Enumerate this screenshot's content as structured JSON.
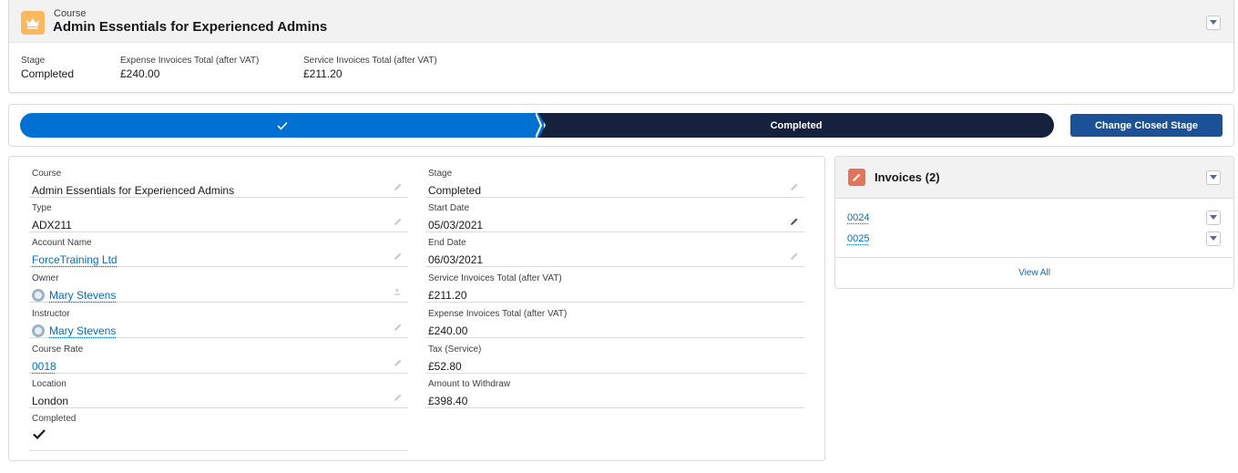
{
  "header": {
    "object_type": "Course",
    "title": "Admin Essentials for Experienced Admins",
    "fields": [
      {
        "label": "Stage",
        "value": "Completed"
      },
      {
        "label": "Expense Invoices Total (after VAT)",
        "value": "£240.00"
      },
      {
        "label": "Service Invoices Total (after VAT)",
        "value": "£211.20"
      }
    ]
  },
  "path": {
    "current_stage": "Completed",
    "button_label": "Change Closed Stage"
  },
  "details": {
    "left": [
      {
        "label": "Course",
        "value": "Admin Essentials for Experienced Admins"
      },
      {
        "label": "Type",
        "value": "ADX211"
      },
      {
        "label": "Account Name",
        "value": "ForceTraining Ltd"
      },
      {
        "label": "Owner",
        "value": "Mary Stevens"
      },
      {
        "label": "Instructor",
        "value": "Mary Stevens"
      },
      {
        "label": "Course Rate",
        "value": "0018"
      },
      {
        "label": "Location",
        "value": "London"
      },
      {
        "label": "Completed",
        "value": ""
      }
    ],
    "right": [
      {
        "label": "Stage",
        "value": "Completed"
      },
      {
        "label": "Start Date",
        "value": "05/03/2021"
      },
      {
        "label": "End Date",
        "value": "06/03/2021"
      },
      {
        "label": "Service Invoices Total (after VAT)",
        "value": "£211.20"
      },
      {
        "label": "Expense Invoices Total (after VAT)",
        "value": "£240.00"
      },
      {
        "label": "Tax (Service)",
        "value": "£52.80"
      },
      {
        "label": "Amount to Withdraw",
        "value": "£398.40"
      }
    ]
  },
  "invoices": {
    "title": "Invoices (2)",
    "items": [
      "0024",
      "0025"
    ],
    "view_all": "View All"
  },
  "colors": {
    "path_complete": "#0070d2",
    "path_current": "#16213e",
    "button": "#1b5297",
    "course_icon": "#fcb95b",
    "invoice_icon": "#e3735a",
    "link": "#006dcc"
  }
}
